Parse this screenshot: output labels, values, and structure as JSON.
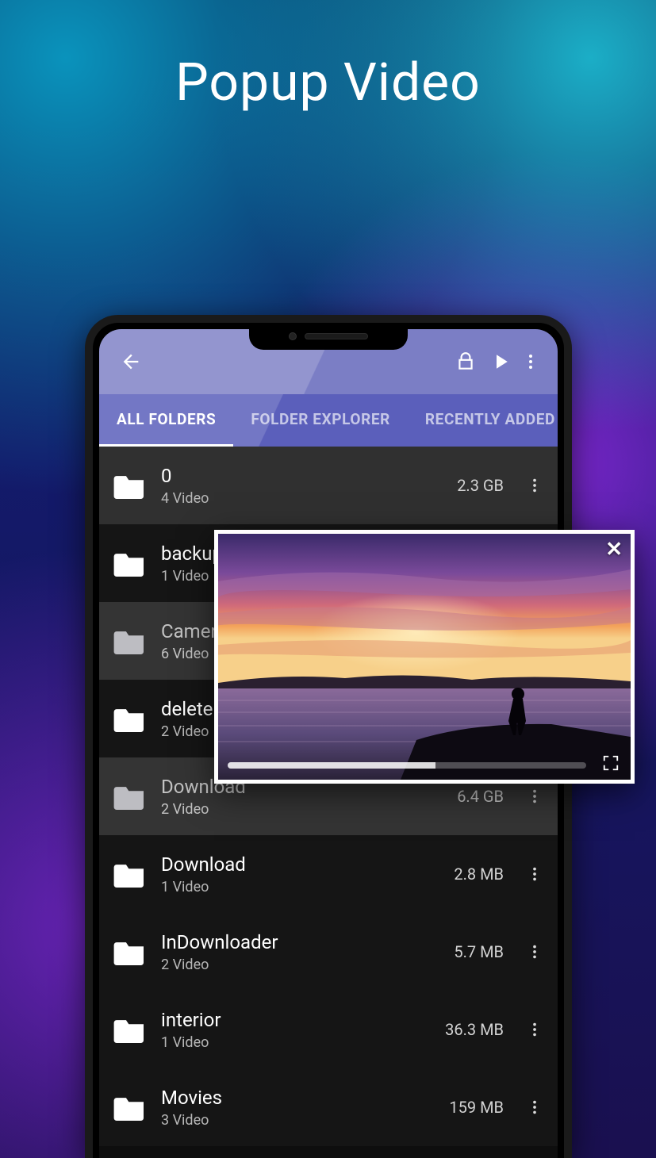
{
  "page": {
    "title": "Popup Video"
  },
  "appbar": {
    "back_icon": "back-arrow-icon",
    "lock_icon": "lock-icon",
    "play_icon": "play-icon",
    "overflow_icon": "more-vert-icon"
  },
  "tabs": [
    {
      "label": "ALL FOLDERS",
      "active": true
    },
    {
      "label": "FOLDER EXPLORER",
      "active": false
    },
    {
      "label": "RECENTLY ADDED",
      "active": false
    }
  ],
  "folders": [
    {
      "name": "0",
      "sub": "4 Video",
      "size": "2.3 GB",
      "shade": "med"
    },
    {
      "name": "backup",
      "sub": "1 Video",
      "size": "",
      "shade": "dark"
    },
    {
      "name": "Camera",
      "sub": "6 Video",
      "size": "",
      "shade": "light"
    },
    {
      "name": "delete",
      "sub": "2 Video",
      "size": "",
      "shade": "dark"
    },
    {
      "name": "Download",
      "sub": "2 Video",
      "size": "6.4 GB",
      "shade": "light"
    },
    {
      "name": "Download",
      "sub": "1 Video",
      "size": "2.8 MB",
      "shade": "dark"
    },
    {
      "name": "InDownloader",
      "sub": "2 Video",
      "size": "5.7 MB",
      "shade": "dark"
    },
    {
      "name": "interior",
      "sub": "1 Video",
      "size": "36.3 MB",
      "shade": "dark"
    },
    {
      "name": "Movies",
      "sub": "3 Video",
      "size": "159 MB",
      "shade": "dark"
    }
  ],
  "popup": {
    "close_icon": "close-icon",
    "fullscreen_icon": "fullscreen-icon",
    "progress_percent": 58
  }
}
